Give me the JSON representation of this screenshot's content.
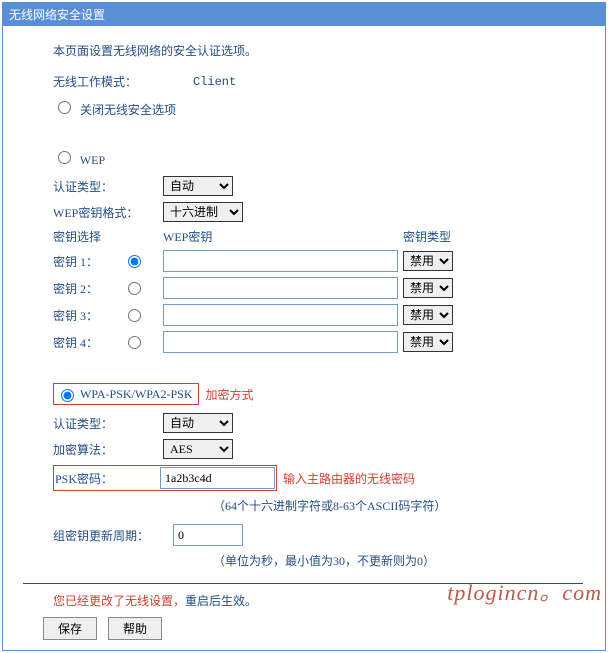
{
  "header": {
    "title": "无线网络安全设置"
  },
  "desc": "本页面设置无线网络的安全认证选项。",
  "mode": {
    "label": "无线工作模式：",
    "value": "Client"
  },
  "opt_disable": "关闭无线安全选项",
  "opt_wep": "WEP",
  "wep": {
    "auth_label": "认证类型：",
    "auth_value": "自动",
    "fmt_label": "WEP密钥格式：",
    "fmt_value": "十六进制",
    "col_select": "密钥选择",
    "col_key": "WEP密钥",
    "col_type": "密钥类型",
    "rows": [
      {
        "label": "密钥 1：",
        "value": "",
        "type": "禁用"
      },
      {
        "label": "密钥 2：",
        "value": "",
        "type": "禁用"
      },
      {
        "label": "密钥 3：",
        "value": "",
        "type": "禁用"
      },
      {
        "label": "密钥 4：",
        "value": "",
        "type": "禁用"
      }
    ]
  },
  "wpa": {
    "name": "WPA-PSK/WPA2-PSK",
    "ann_method": "加密方式",
    "auth_label": "认证类型：",
    "auth_value": "自动",
    "algo_label": "加密算法：",
    "algo_value": "AES",
    "psk_label": "PSK密码：",
    "psk_value": "1a2b3c4d",
    "psk_ann": "输入主路由器的无线密码",
    "psk_note": "（64个十六进制字符或8-63个ASCII码字符）",
    "group_label": "组密钥更新周期：",
    "group_value": "0",
    "group_note": "（单位为秒，最小值为30，不更新则为0）"
  },
  "footer": {
    "changed": "您已经更改了无线设置，",
    "reboot": "重启后生效。",
    "save": "保存",
    "help": "帮助"
  },
  "watermark": "tplogincn。com"
}
